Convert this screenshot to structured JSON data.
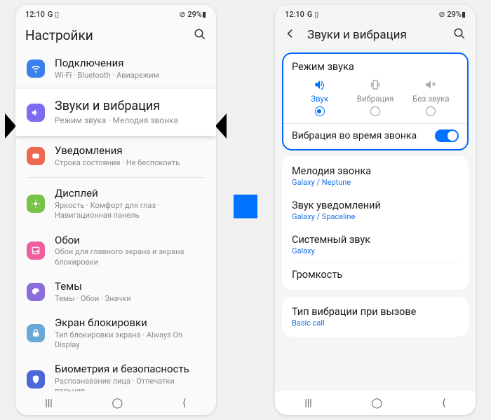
{
  "status": {
    "time": "12:10",
    "icons": "G ▯",
    "right": "⊘ 29%▮"
  },
  "left": {
    "title": "Настройки",
    "items": [
      {
        "icon": "wifi",
        "color": "#3b7fec",
        "title": "Подключения",
        "sub": "Wi-Fi · Bluetooth · Авиарежим"
      },
      {
        "icon": "sound",
        "color": "#7b6cf0",
        "title": "Звуки и вибрация",
        "sub": "Режим звука · Мелодия звонка",
        "highlight": true
      },
      {
        "icon": "notif",
        "color": "#ed6752",
        "title": "Уведомления",
        "sub": "Строка состояния · Не беспокоить"
      },
      {
        "icon": "display",
        "color": "#78c347",
        "title": "Дисплей",
        "sub": "Яркость · Комфорт для глаз · Навигационная панель"
      },
      {
        "icon": "wall",
        "color": "#ef5fa0",
        "title": "Обои",
        "sub": "Обои для главного экрана и экрана блокировки"
      },
      {
        "icon": "theme",
        "color": "#8b6cd9",
        "title": "Темы",
        "sub": "Темы · Обои · Значки"
      },
      {
        "icon": "lock",
        "color": "#6aa8d8",
        "title": "Экран блокировки",
        "sub": "Тип блокировки экрана · Always On Display"
      },
      {
        "icon": "bio",
        "color": "#4d67d8",
        "title": "Биометрия и безопасность",
        "sub": "Распознавание лица · Отпечатки пальцев"
      }
    ]
  },
  "right": {
    "title": "Звуки и вибрация",
    "panel": {
      "title": "Режим звука",
      "modes": [
        {
          "label": "Звук",
          "selected": true
        },
        {
          "label": "Вибрация",
          "selected": false
        },
        {
          "label": "Без звука",
          "selected": false
        }
      ],
      "vibrate_label": "Вибрация во время звонка",
      "vibrate_on": true
    },
    "settings1": [
      {
        "title": "Мелодия звонка",
        "sub": "Galaxy / Neptune"
      },
      {
        "title": "Звук уведомлений",
        "sub": "Galaxy / Spaceline"
      },
      {
        "title": "Системный звук",
        "sub": "Galaxy"
      },
      {
        "title": "Громкость",
        "sub": ""
      }
    ],
    "settings2": [
      {
        "title": "Тип вибрации при вызове",
        "sub": "Basic call"
      }
    ]
  },
  "nav": {
    "recent": "|||",
    "home": "◯",
    "back": "⟨"
  }
}
